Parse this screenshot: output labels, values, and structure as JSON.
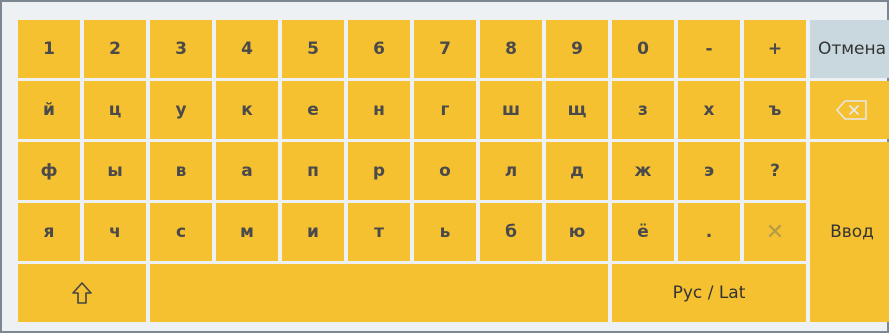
{
  "keyboard": {
    "row1": [
      "1",
      "2",
      "3",
      "4",
      "5",
      "6",
      "7",
      "8",
      "9",
      "0",
      "-",
      "+"
    ],
    "row2": [
      "й",
      "ц",
      "у",
      "к",
      "е",
      "н",
      "г",
      "ш",
      "щ",
      "з",
      "х",
      "ъ"
    ],
    "row3": [
      "ф",
      "ы",
      "в",
      "а",
      "п",
      "р",
      "о",
      "л",
      "д",
      "ж",
      "э",
      "?"
    ],
    "row4": [
      "я",
      "ч",
      "с",
      "м",
      "и",
      "т",
      "ь",
      "б",
      "ю",
      "ё",
      "."
    ],
    "cancel_label": "Отмена",
    "enter_label": "Ввод",
    "lang_label": "Рус / Lat",
    "clear_glyph": "✕",
    "icons": {
      "backspace": "backspace-icon",
      "shift": "shift-arrow-icon"
    },
    "colors": {
      "key": "#f5c131",
      "cancel": "#c9d7de",
      "background": "#eef1f4",
      "border": "#7d8791"
    }
  }
}
